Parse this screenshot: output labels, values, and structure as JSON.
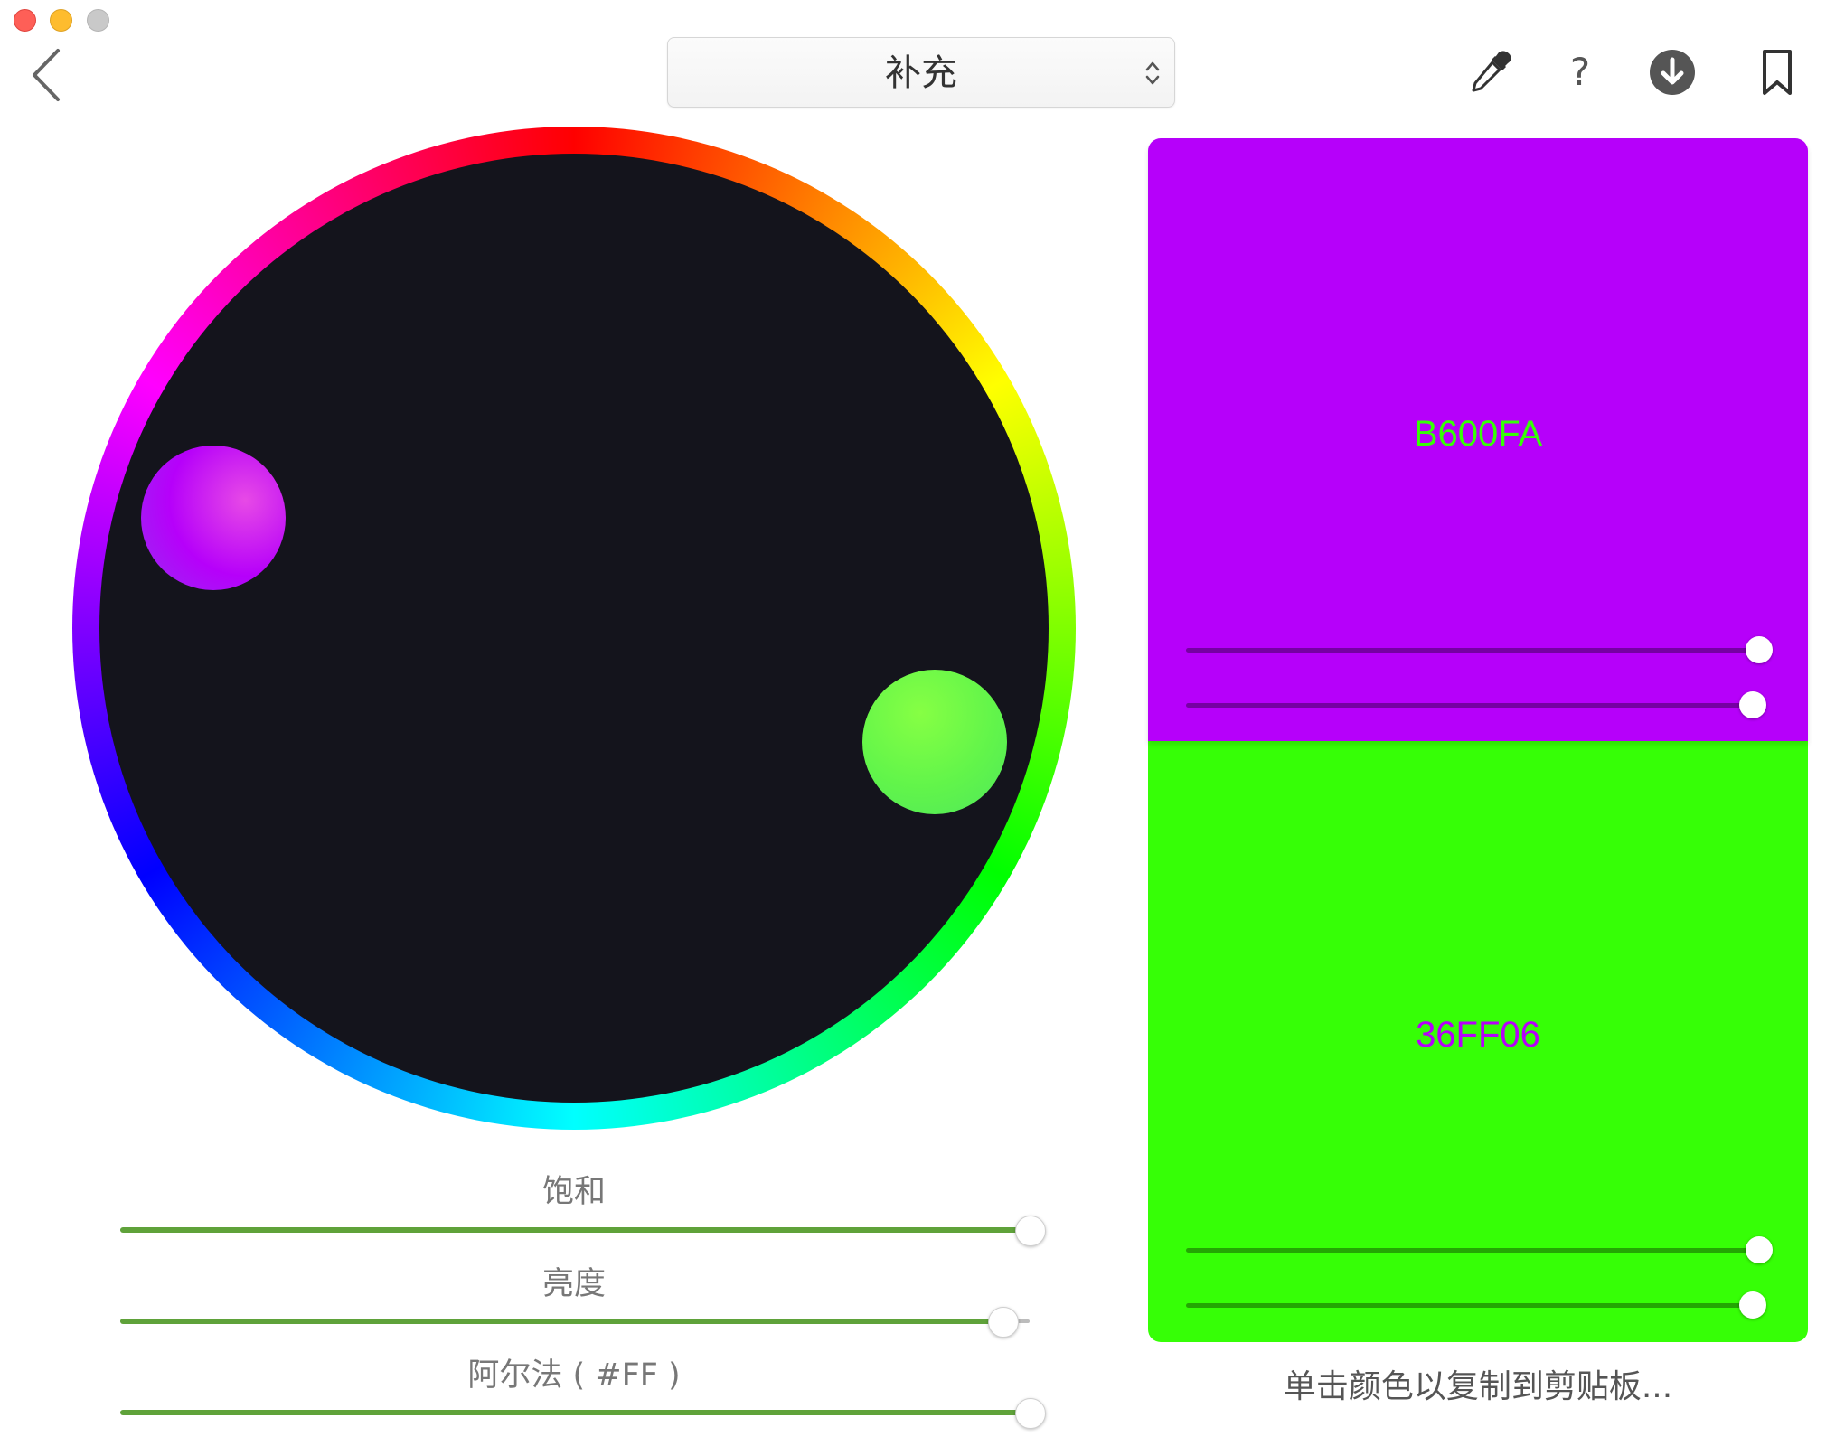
{
  "window": {
    "controls": [
      "close",
      "minimize",
      "maximize"
    ]
  },
  "toolbar": {
    "back_icon": "chevron-left-icon",
    "mode_select": {
      "value": "补充",
      "icon": "up-down-arrows-icon"
    },
    "tools": [
      {
        "name": "eyedropper",
        "icon": "eyedropper-icon"
      },
      {
        "name": "help",
        "icon": "question-mark-icon",
        "glyph": "?"
      },
      {
        "name": "download",
        "icon": "download-icon"
      },
      {
        "name": "bookmark",
        "icon": "bookmark-icon"
      }
    ]
  },
  "wheel": {
    "handles": [
      {
        "color": "#B600FA"
      },
      {
        "color": "#36FF06"
      }
    ]
  },
  "sliders": [
    {
      "label": "饱和",
      "value": 1.0
    },
    {
      "label": "亮度",
      "value": 0.97
    },
    {
      "label": "阿尔法 ( #FF )",
      "value": 1.0
    }
  ],
  "swatches": [
    {
      "hex": "B600FA",
      "background": "#B600FA",
      "text_color": "#36FF06",
      "slider_values": [
        0.99,
        0.98
      ]
    },
    {
      "hex": "36FF06",
      "background": "#36FF06",
      "text_color": "#B600FA",
      "slider_values": [
        0.99,
        0.98
      ]
    }
  ],
  "hint": "单击颜色以复制到剪贴板..."
}
